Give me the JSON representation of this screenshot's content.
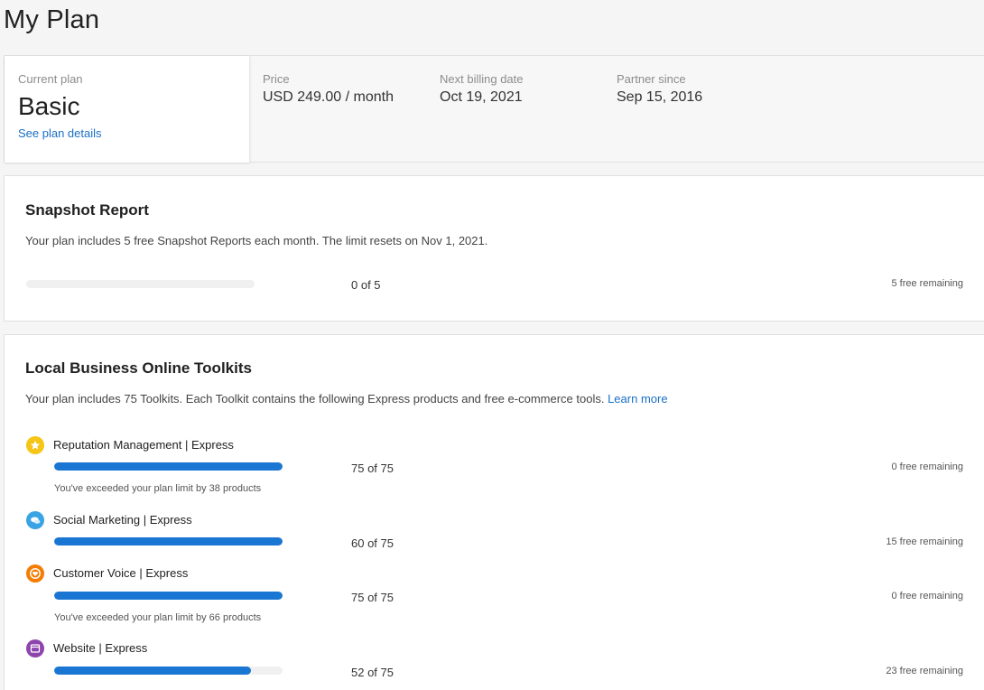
{
  "page": {
    "title": "My Plan"
  },
  "plan": {
    "current_label": "Current plan",
    "current_value": "Basic",
    "details_link": "See plan details",
    "price_label": "Price",
    "price_value": "USD 249.00 / month",
    "billing_label": "Next billing date",
    "billing_value": "Oct 19, 2021",
    "partner_label": "Partner since",
    "partner_value": "Sep 15, 2016"
  },
  "snapshot": {
    "title": "Snapshot Report",
    "description": "Your plan includes 5 free Snapshot Reports each month. The limit resets on Nov 1, 2021.",
    "progress": 0,
    "count": "0 of 5",
    "remaining": "5 free remaining"
  },
  "toolkits": {
    "title": "Local Business Online Toolkits",
    "description": "Your plan includes 75 Toolkits. Each Toolkit contains the following Express products and free e-commerce tools.",
    "learn_more": "Learn more",
    "products": [
      {
        "name": "Reputation Management | Express",
        "icon": "star-icon",
        "color": "#f5c518",
        "progress": 1.0,
        "count": "75 of 75",
        "remaining": "0 free remaining",
        "warning": "You've exceeded your plan limit by 38 products"
      },
      {
        "name": "Social Marketing | Express",
        "icon": "speech-bubbles-icon",
        "color": "#3aa3e3",
        "progress": 1.0,
        "count": "60 of 75",
        "remaining": "15 free remaining",
        "warning": ""
      },
      {
        "name": "Customer Voice | Express",
        "icon": "heart-icon",
        "color": "#f57c00",
        "progress": 1.0,
        "count": "75 of 75",
        "remaining": "0 free remaining",
        "warning": "You've exceeded your plan limit by 66 products"
      },
      {
        "name": "Website | Express",
        "icon": "browser-window-icon",
        "color": "#8e44ad",
        "progress": 0.86,
        "count": "52 of 75",
        "remaining": "23 free remaining",
        "warning": ""
      }
    ]
  },
  "colors": {
    "accent": "#1976d2",
    "link": "#1a6fc4"
  }
}
